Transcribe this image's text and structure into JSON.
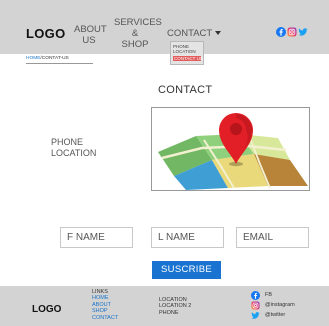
{
  "header": {
    "logo": "LOGO",
    "nav": {
      "about": [
        "ABOUT",
        "US"
      ],
      "services": [
        "SERVICES",
        "&",
        "SHOP"
      ],
      "contact": "CONTACT"
    },
    "dropdown": {
      "items": [
        "PHONE",
        "LOCATION",
        "CONTACT US"
      ],
      "active_index": 2
    },
    "socials": [
      {
        "icon": "facebook-icon",
        "color": "#1877f2"
      },
      {
        "icon": "instagram-icon",
        "color": "#e1306c"
      },
      {
        "icon": "twitter-icon",
        "color": "#1da1f2"
      }
    ]
  },
  "breadcrumb": {
    "home": "HOME",
    "separator": "/",
    "current": "CONTAT-US"
  },
  "main": {
    "title": "CONTACT",
    "info_lines": [
      "PHONE",
      "LOCATION"
    ],
    "map_icon": "map-location-pin-icon"
  },
  "form": {
    "first_name_placeholder": "F NAME",
    "last_name_placeholder": "L NAME",
    "email_placeholder": "EMAIL",
    "submit_label": "SUSCRIBE",
    "accent_color": "#1a73d0"
  },
  "footer": {
    "logo": "LOGO",
    "links_heading": "LINKS",
    "links": [
      "HOME",
      "ABOUT",
      "SHOP",
      "CONTACT"
    ],
    "contact_lines": [
      "LOCATION",
      "LOCATION 2",
      "PHONE"
    ],
    "social": [
      {
        "icon": "facebook-icon",
        "label": "FB"
      },
      {
        "icon": "instagram-icon",
        "label": "@instagram"
      },
      {
        "icon": "twitter-icon",
        "label": "@twitter"
      }
    ]
  }
}
